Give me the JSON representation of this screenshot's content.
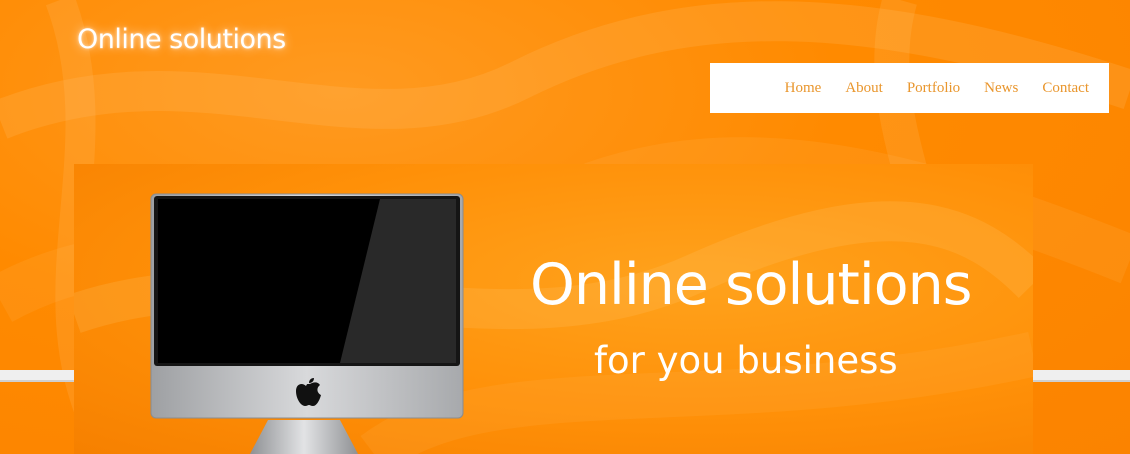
{
  "header": {
    "logo_text": "Online solutions"
  },
  "nav": {
    "items": [
      "Home",
      "About",
      "Portfolio",
      "News",
      "Contact"
    ]
  },
  "banner": {
    "title": "Online solutions",
    "subtitle": "for you business"
  },
  "icons": {
    "product_image": "imac-icon",
    "brand_logo": "apple-logo-icon"
  },
  "colors": {
    "accent": "#ff8a00",
    "nav_text": "#e9962d",
    "nav_bg": "#ffffff"
  }
}
